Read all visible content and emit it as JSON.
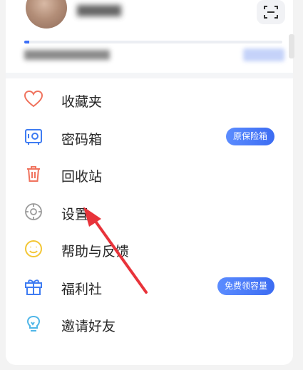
{
  "header": {
    "storage_used_fraction": 0.02
  },
  "menu": {
    "items": [
      {
        "label": "收藏夹",
        "icon": "heart-icon"
      },
      {
        "label": "密码箱",
        "icon": "safe-icon",
        "badge": "原保险箱"
      },
      {
        "label": "回收站",
        "icon": "trash-icon"
      },
      {
        "label": "设置",
        "icon": "gear-icon"
      },
      {
        "label": "帮助与反馈",
        "icon": "smiley-icon"
      },
      {
        "label": "福利社",
        "icon": "gift-icon",
        "badge": "免费领容量"
      },
      {
        "label": "邀请好友",
        "icon": "lightbulb-icon"
      }
    ]
  },
  "colors": {
    "accent": "#3c6cf2",
    "heart": "#f0735e",
    "safe": "#3f7cf2",
    "trash": "#f0735e",
    "gear": "#9a9a9a",
    "smiley": "#f3c634",
    "gift": "#3f7cf2",
    "bulb": "#4fb6e8",
    "annotation_arrow": "#e8333a"
  }
}
